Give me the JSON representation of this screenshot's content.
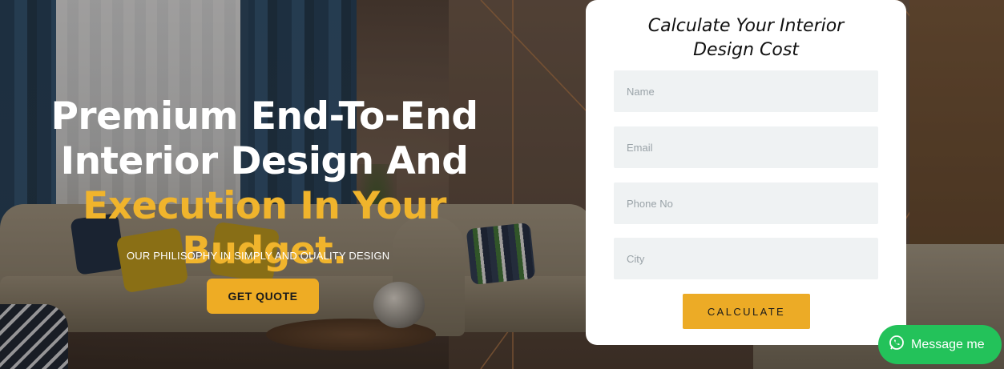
{
  "hero": {
    "headline_line1": "Premium End-To-End",
    "headline_line2": "Interior Design And",
    "headline_line3": "Execution In Your Budget.",
    "tagline": "OUR PHILISOPHY IN SIMPLY AND QUALITY DESIGN",
    "cta_label": "GET QUOTE"
  },
  "form": {
    "title_line1": "Calculate Your Interior",
    "title_line2": "Design Cost",
    "fields": [
      {
        "placeholder": "Name",
        "value": ""
      },
      {
        "placeholder": "Email",
        "value": ""
      },
      {
        "placeholder": "Phone No",
        "value": ""
      },
      {
        "placeholder": "City",
        "value": ""
      }
    ],
    "submit_label": "CALCULATE"
  },
  "chat_widget": {
    "label": "Message me",
    "icon": "whatsapp-icon"
  },
  "colors": {
    "accent": "#eeac24",
    "headline_highlight": "#f0b42c",
    "whatsapp": "#23c25a"
  }
}
